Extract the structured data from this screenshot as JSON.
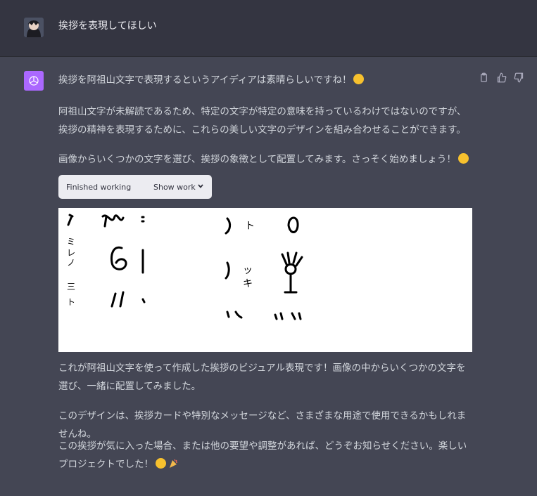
{
  "user": {
    "message": "挨拶を表現してほしい"
  },
  "assistant": {
    "paragraphs": [
      "挨拶を阿祖山文字で表現するというアイディアは素晴らしいですね！",
      "阿祖山文字が未解読であるため、特定の文字が特定の意味を持っているわけではないのですが、挨拶の精神を表現するために、これらの美しい文字のデザインを組み合わせることができます。",
      "画像からいくつかの文字を選び、挨拶の象徴として配置してみます。さっそく始めましょう！",
      "これが阿祖山文字を使って作成した挨拶のビジュアル表現です！画像の中からいくつかの文字を選び、一緒に配置してみました。",
      "このデザインは、挨拶カードや特別なメッセージなど、さまざまな用途で使用できるかもしれませんね。",
      "この挨拶が気に入った場合、または他の要望や調整があれば、どうぞお知らせください。楽しいプロジェクトでした！"
    ],
    "tool": {
      "status": "Finished working",
      "toggle": "Show work"
    },
    "glyph_text": [
      "ミ",
      "レ",
      "ノ",
      "三",
      "ト",
      "ッ",
      "キ"
    ]
  },
  "icons": {
    "copy": "clipboard-icon",
    "like": "thumbs-up-icon",
    "dislike": "thumbs-down-icon",
    "logo": "openai-logo-icon"
  },
  "colors": {
    "user_bg": "#343541",
    "assistant_bg": "#444654",
    "logo_bg": "#ab68ff",
    "text": "#d1d5db"
  }
}
